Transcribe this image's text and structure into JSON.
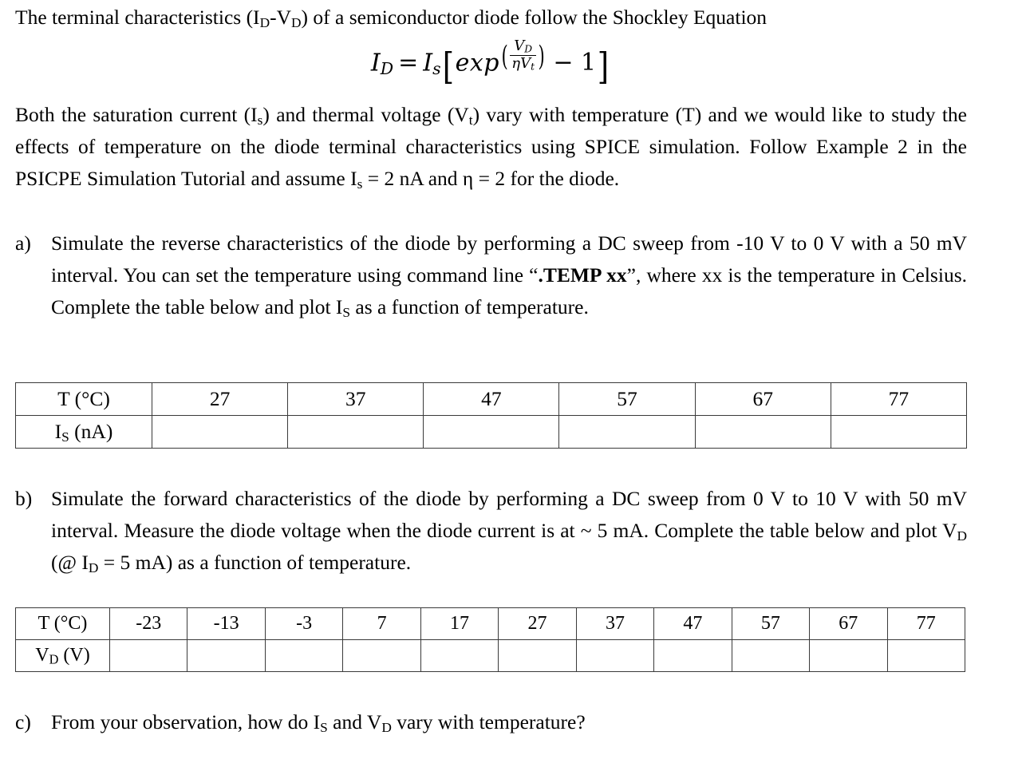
{
  "document": {
    "intro_line": {
      "pre": "The terminal characteristics (I",
      "sub1": "D",
      "mid": "-V",
      "sub2": "D",
      "post": ") of a semiconductor diode follow the Shockley Equation"
    },
    "equation": {
      "lhs_var": "I",
      "lhs_sub": "D",
      "equals": "=",
      "is_var": "I",
      "is_sub": "s",
      "bracket_open": "[",
      "exp_word": "exp",
      "paren_open": "(",
      "numerator_var": "V",
      "numerator_sub": "D",
      "denominator_eta": "ηV",
      "denominator_sub": "t",
      "paren_close": ")",
      "minus_one": "− 1",
      "bracket_close": "]",
      "plain_text": "I_D = I_s [ exp^(V_D / (η V_t)) − 1 ]"
    },
    "body_paragraph": {
      "part1": "Both the saturation current (I",
      "sub1": "s",
      "part2": ") and thermal voltage (V",
      "sub2": "t",
      "part3": ") vary with temperature (T) and we would like to study the effects of temperature on the diode terminal characteristics using SPICE simulation. Follow Example 2 in the PSICPE Simulation Tutorial and assume I",
      "sub3": "s",
      "part4": " = 2 nA and η = 2 for the diode."
    },
    "items": [
      {
        "marker": "a)",
        "text_part1": "Simulate the reverse characteristics of the diode by performing a DC sweep from -10 V to 0 V with a 50 mV interval. You can set the temperature using command line “",
        "bold_command": ".TEMP xx",
        "text_part2": "”, where xx is the temperature in Celsius. Complete the table below and plot I",
        "sub_s": "S",
        "text_part3": " as a function of temperature."
      },
      {
        "marker": "b)",
        "text_part1": "Simulate the forward characteristics of the diode by performing a DC sweep from 0 V to 10 V with 50 mV interval. Measure the diode voltage when the diode current is at ~ 5 mA. Complete the table below and plot V",
        "sub_d1": "D",
        "text_part2": " (@ I",
        "sub_d2": "D",
        "text_part3": " = 5 mA) as a function of temperature."
      },
      {
        "marker": "c)",
        "text_part1": "From your observation, how do I",
        "sub_s": "S",
        "text_part2": " and V",
        "sub_d": "D",
        "text_part3": " vary with temperature?"
      }
    ],
    "table_is": {
      "row_label_temp_pre": "T (",
      "row_label_temp_unit": "°C)",
      "row_label_temp": "T (°C)",
      "row_label_is_pre": "I",
      "row_label_is_sub": "S",
      "row_label_is_post": " (nA)",
      "temperatures": [
        "27",
        "37",
        "47",
        "57",
        "67",
        "77"
      ],
      "is_values": [
        "",
        "",
        "",
        "",
        "",
        ""
      ]
    },
    "table_vd": {
      "row_label_temp": "T (°C)",
      "row_label_vd_pre": "V",
      "row_label_vd_sub": "D",
      "row_label_vd_post": " (V)",
      "temperatures": [
        "-23",
        "-13",
        "-3",
        "7",
        "17",
        "27",
        "37",
        "47",
        "57",
        "67",
        "77"
      ],
      "vd_values": [
        "",
        "",
        "",
        "",
        "",
        "",
        "",
        "",
        "",
        "",
        ""
      ]
    }
  }
}
